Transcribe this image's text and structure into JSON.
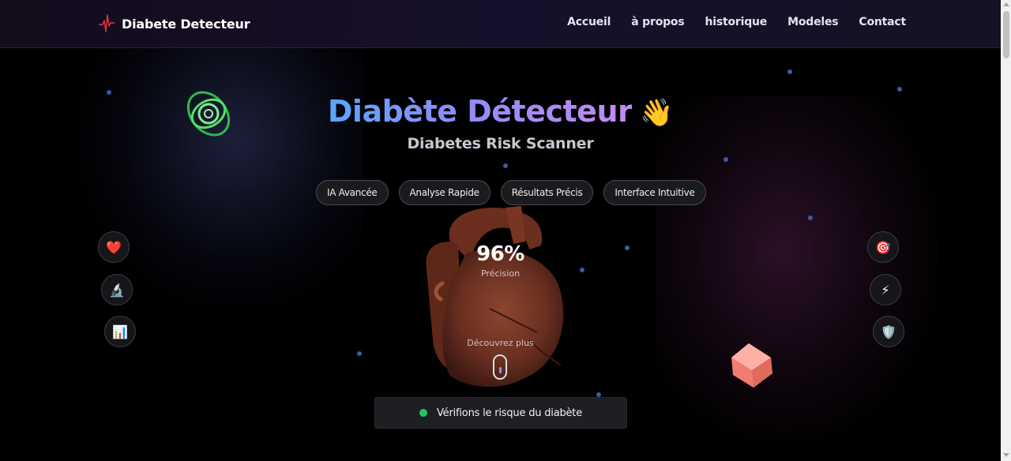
{
  "nav": {
    "brand": "Diabete Detecteur",
    "logo_icon": "heartbeat-icon",
    "links": [
      "Accueil",
      "à propos",
      "historique",
      "Modeles",
      "Contact"
    ]
  },
  "hero": {
    "title_part1": "Diabète Détecteur",
    "title_emoji": "👋",
    "subtitle": "Diabetes Risk Scanner",
    "features": [
      "IA Avancée",
      "Analyse Rapide",
      "Résultats Précis",
      "Interface Intuitive"
    ],
    "stat_value": "96%",
    "stat_label": "Précision",
    "discover": "Découvrez plus",
    "cta_label": "Vérifions le risque du diabète"
  },
  "side_icons": {
    "left": [
      {
        "name": "heart-icon",
        "glyph": "❤️"
      },
      {
        "name": "microscope-icon",
        "glyph": "🔬"
      },
      {
        "name": "chart-icon",
        "glyph": "📊"
      }
    ],
    "right": [
      {
        "name": "target-icon",
        "glyph": "🎯"
      },
      {
        "name": "lightning-icon",
        "glyph": "⚡"
      },
      {
        "name": "shield-icon",
        "glyph": "🛡️"
      }
    ]
  },
  "colors": {
    "accent_blue": "#5aa5ff",
    "accent_purple": "#c68af2",
    "status_green": "#22c55e",
    "heart_brown": "#7a3a26",
    "cube_pink": "#f08a7e"
  }
}
